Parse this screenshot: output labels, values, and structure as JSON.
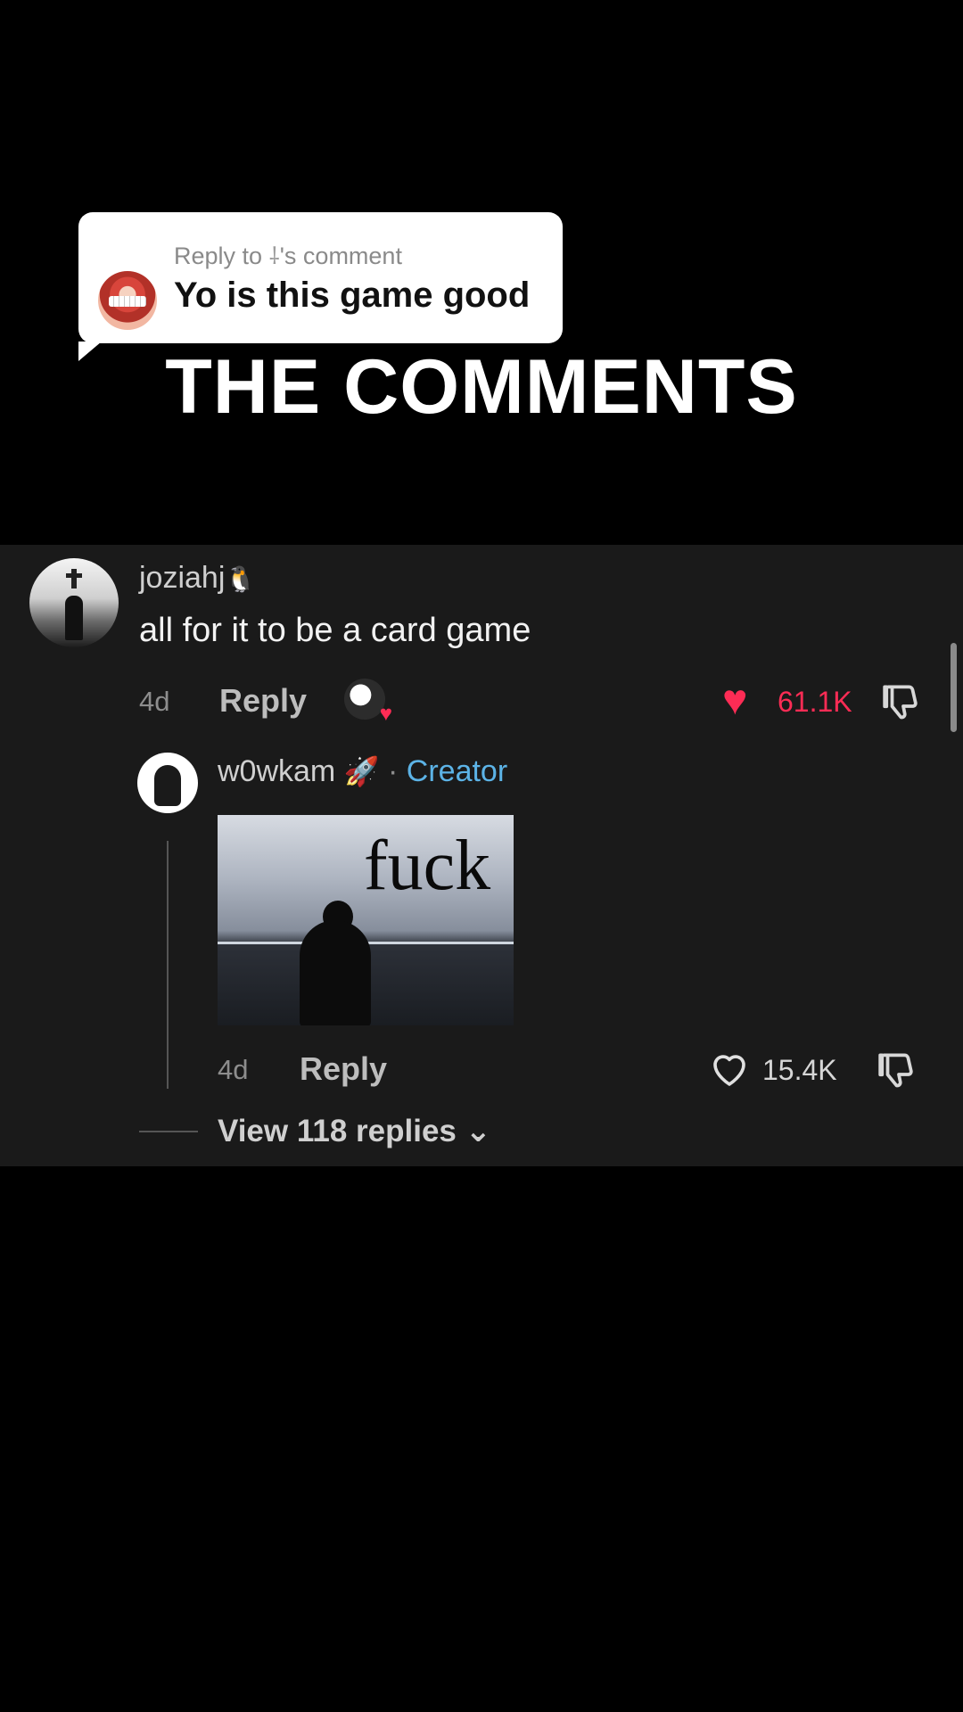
{
  "reply_bubble": {
    "prefix": "Reply to ",
    "glyph": "⸸",
    "suffix": "'s comment",
    "text": "Yo is this game good"
  },
  "headline": "THE COMMENTS",
  "comment": {
    "username": "joziahj",
    "username_emoji": "🐧",
    "text": "all for it to be a card game",
    "time": "4d",
    "reply_label": "Reply",
    "likes": "61.1K",
    "liked": true
  },
  "reply": {
    "username": "w0wkam",
    "username_emoji": "🚀",
    "separator": "·",
    "badge": "Creator",
    "image_caption": "fuck",
    "time": "4d",
    "reply_label": "Reply",
    "likes": "15.4K",
    "liked": false
  },
  "view_replies": {
    "label": "View 118 replies",
    "chevron": "⌄"
  },
  "colors": {
    "panel": "#1a1a1a",
    "like_red": "#fe2c55",
    "creator_blue": "#5cb3e6"
  }
}
